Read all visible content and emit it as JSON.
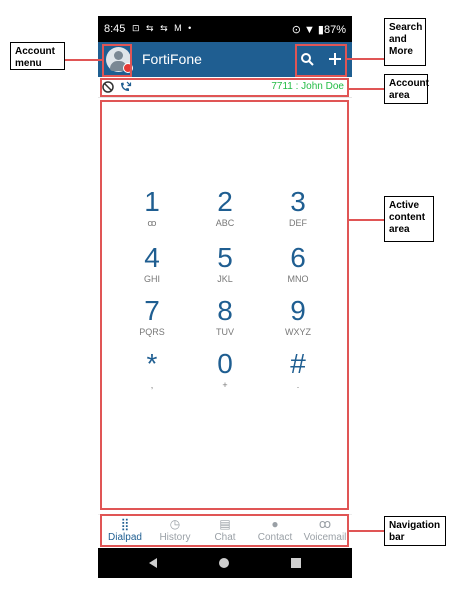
{
  "status_bar": {
    "time": "8:45",
    "notifications": "⊡ ⇆ ⇆ M •",
    "right": "⊙ ▼ ▮87%"
  },
  "app_bar": {
    "title": "FortiFone"
  },
  "account_bar": {
    "extension": "7711 : John Doe"
  },
  "dialpad": {
    "keys": [
      {
        "digit": "1",
        "sub": "ꝏ"
      },
      {
        "digit": "2",
        "sub": "ABC"
      },
      {
        "digit": "3",
        "sub": "DEF"
      },
      {
        "digit": "4",
        "sub": "GHI"
      },
      {
        "digit": "5",
        "sub": "JKL"
      },
      {
        "digit": "6",
        "sub": "MNO"
      },
      {
        "digit": "7",
        "sub": "PQRS"
      },
      {
        "digit": "8",
        "sub": "TUV"
      },
      {
        "digit": "9",
        "sub": "WXYZ"
      },
      {
        "digit": "*",
        "sub": ","
      },
      {
        "digit": "0",
        "sub": "+"
      },
      {
        "digit": "#",
        "sub": "."
      }
    ]
  },
  "nav": {
    "items": [
      {
        "label": "Dialpad",
        "icon": "⣿",
        "icon_name": "dialpad-icon"
      },
      {
        "label": "History",
        "icon": "◷",
        "icon_name": "clock-icon"
      },
      {
        "label": "Chat",
        "icon": "▤",
        "icon_name": "chat-icon"
      },
      {
        "label": "Contact",
        "icon": "●",
        "icon_name": "person-icon"
      },
      {
        "label": "Voicemail",
        "icon": "ꝏ",
        "icon_name": "voicemail-icon"
      }
    ]
  },
  "annotations": {
    "account_menu": "Account menu",
    "search_more": "Search and More",
    "account_area": "Account area",
    "active_content": "Active content area",
    "navigation_bar": "Navigation bar"
  },
  "colors": {
    "brand": "#1f5e91",
    "call": "#21c24a",
    "callout": "#e05555",
    "extension_text": "#22bb44"
  }
}
